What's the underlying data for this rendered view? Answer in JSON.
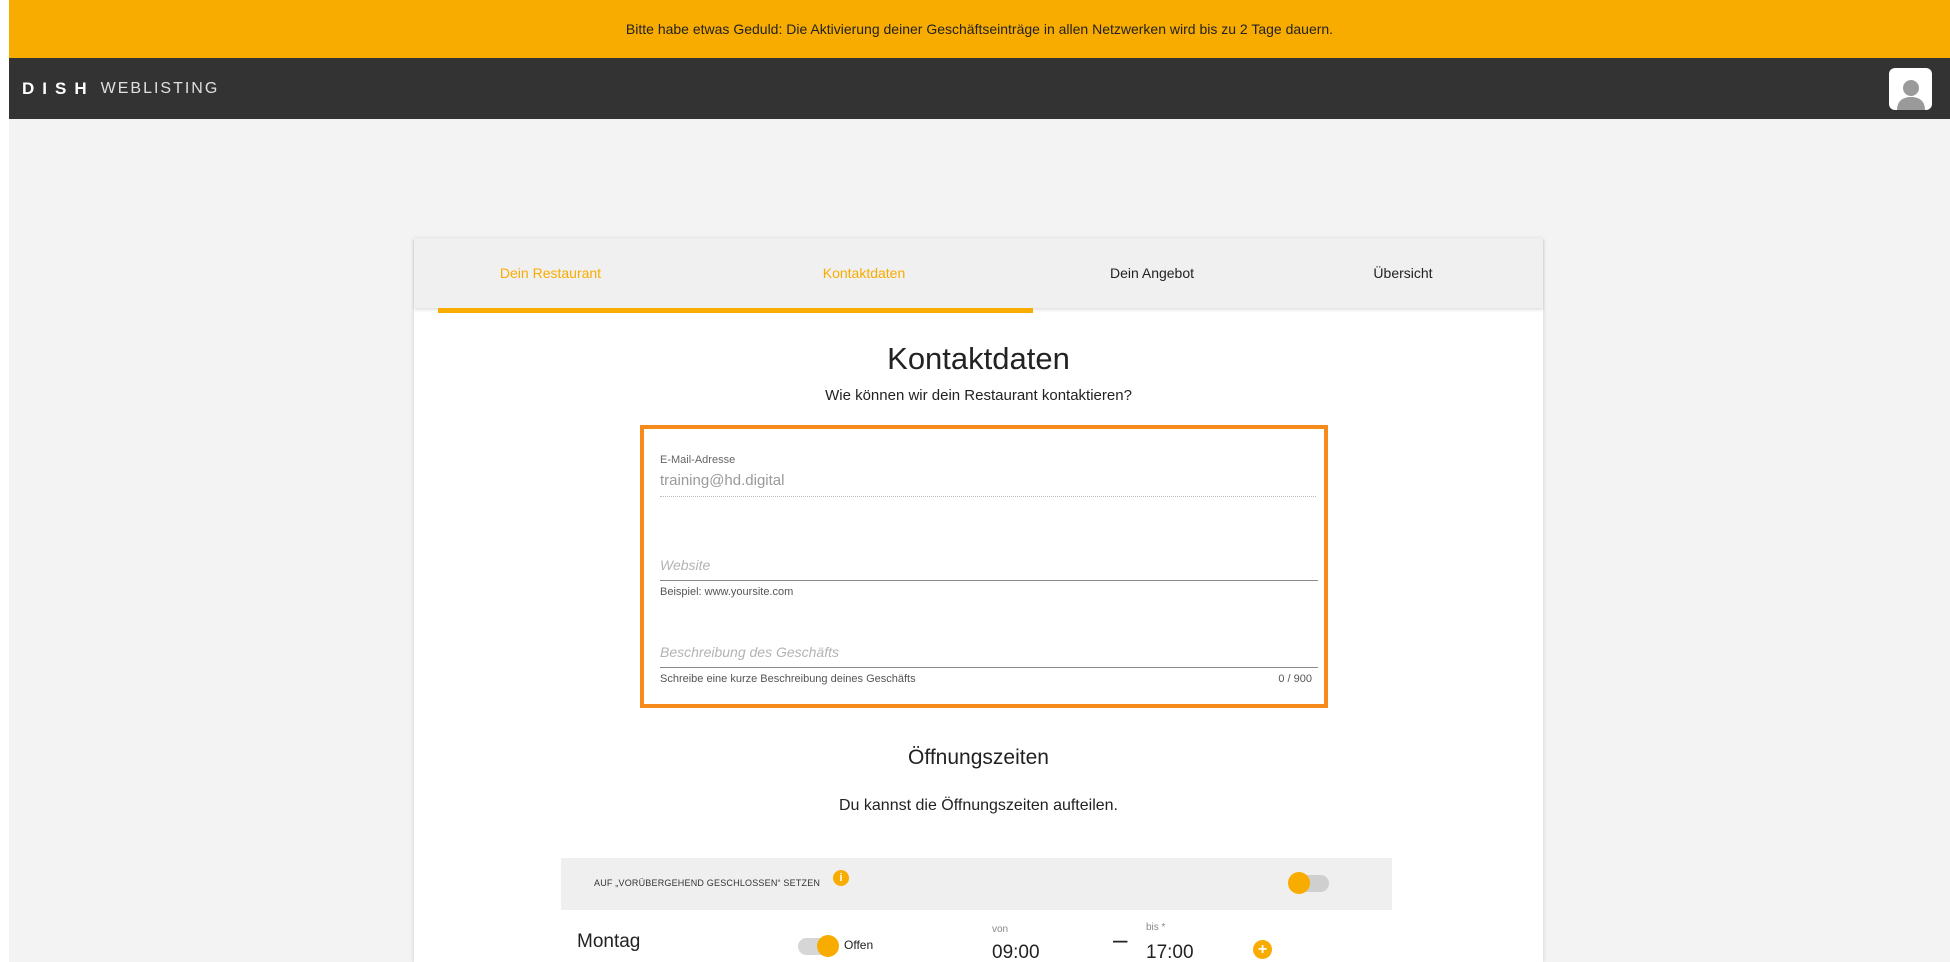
{
  "banner": {
    "text": "Bitte habe etwas Geduld: Die Aktivierung deiner Geschäftseinträge in allen Netzwerken wird bis zu 2 Tage dauern."
  },
  "brand": {
    "strong": "DISH",
    "light": "WEBLISTING"
  },
  "tabs": [
    {
      "label": "Dein Restaurant",
      "state": "done"
    },
    {
      "label": "Kontaktdaten",
      "state": "active"
    },
    {
      "label": "Dein Angebot",
      "state": "todo"
    },
    {
      "label": "Übersicht",
      "state": "todo"
    }
  ],
  "progress": {
    "completed_steps": 2,
    "total_steps": 4
  },
  "contact": {
    "title": "Kontaktdaten",
    "subtitle": "Wie können wir dein Restaurant kontaktieren?",
    "email_label": "E-Mail-Adresse",
    "email_value": "training@hd.digital",
    "website_placeholder": "Website",
    "website_hint": "Beispiel: www.yoursite.com",
    "description_placeholder": "Beschreibung des Geschäfts",
    "description_hint": "Schreibe eine kurze Beschreibung deines Geschäfts",
    "description_counter": "0 / 900"
  },
  "hours": {
    "title": "Öffnungszeiten",
    "subtitle": "Du kannst die Öffnungszeiten aufteilen.",
    "temp_closed_label": "AUF „VORÜBERGEHEND GESCHLOSSEN“ SETZEN",
    "temp_closed_enabled": false,
    "info_glyph": "i",
    "days": [
      {
        "name": "Montag",
        "open": true,
        "open_label": "Offen",
        "from_label": "von",
        "to_label": "bis *",
        "from": "09:00",
        "to": "17:00"
      }
    ],
    "dash": "–",
    "add_glyph": "+"
  },
  "colors": {
    "accent": "#f9ac00",
    "highlight": "#f68a1a",
    "topbar": "#333333"
  },
  "icons": {
    "avatar": "user-avatar-icon",
    "info": "info-icon",
    "add": "plus-circle-icon"
  }
}
